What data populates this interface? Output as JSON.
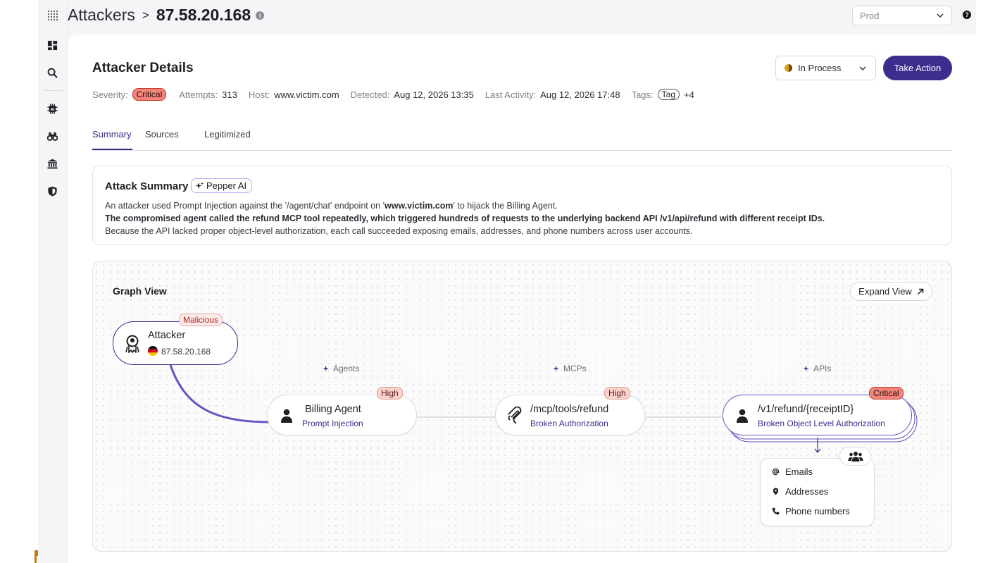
{
  "breadcrumb": {
    "root": "Attackers",
    "separator": ">",
    "current": "87.58.20.168"
  },
  "topbar": {
    "environment": "Prod"
  },
  "header": {
    "title": "Attacker Details",
    "status": "In Process",
    "action_label": "Take Action"
  },
  "meta": {
    "severity_label": "Severity:",
    "severity": "Critical",
    "attempts_label": "Attempts:",
    "attempts": "313",
    "host_label": "Host:",
    "host": "www.victim.com",
    "detected_label": "Detected:",
    "detected": "Aug 12, 2026 13:35",
    "last_activity_label": "Last Activity:",
    "last_activity": "Aug 12, 2026 17:48",
    "tags_label": "Tags:",
    "tag": "Tag",
    "tags_more": "+4"
  },
  "tabs": [
    {
      "label": "Summary",
      "active": true
    },
    {
      "label": "Sources",
      "active": false
    },
    {
      "label": "Legitimized",
      "active": false
    }
  ],
  "summary": {
    "title": "Attack Summary",
    "ai_chip": "Pepper AI",
    "line1_a": "An attacker used Prompt Injection against the '/agent/chat'  endpoint on '",
    "line1_host": "www.victim.com",
    "line1_b": "' to hijack the Billing Agent.",
    "line2": "The compromised agent called the refund MCP tool repeatedly, which triggered hundreds of requests to the underlying backend API /v1/api/refund with different receipt IDs.",
    "line3": "Because the API lacked proper object-level authorization, each call succeeded exposing emails, addresses, and phone numbers across user accounts."
  },
  "graph": {
    "title": "Graph View",
    "expand_label": "Expand View",
    "columns": {
      "agents": "Agents",
      "mcps": "MCPs",
      "apis": "APIs"
    },
    "attacker": {
      "badge": "Malicious",
      "title": "Attacker",
      "ip": "87.58.20.168"
    },
    "agent": {
      "badge": "High",
      "title": "Billing Agent",
      "subtitle": "Prompt Injection"
    },
    "mcp": {
      "badge": "High",
      "title": "/mcp/tools/refund",
      "subtitle": "Broken Authorization"
    },
    "api": {
      "badge": "Critical",
      "title": "/v1/refund/{receiptID}",
      "subtitle": "Broken Object Level Authorization"
    },
    "data_exposed": [
      "Emails",
      "Addresses",
      "Phone numbers"
    ]
  },
  "colors": {
    "accent": "#3d2b8e",
    "critical": "#f2847a",
    "high": "#fbd2cd",
    "status": "#d9a514"
  }
}
